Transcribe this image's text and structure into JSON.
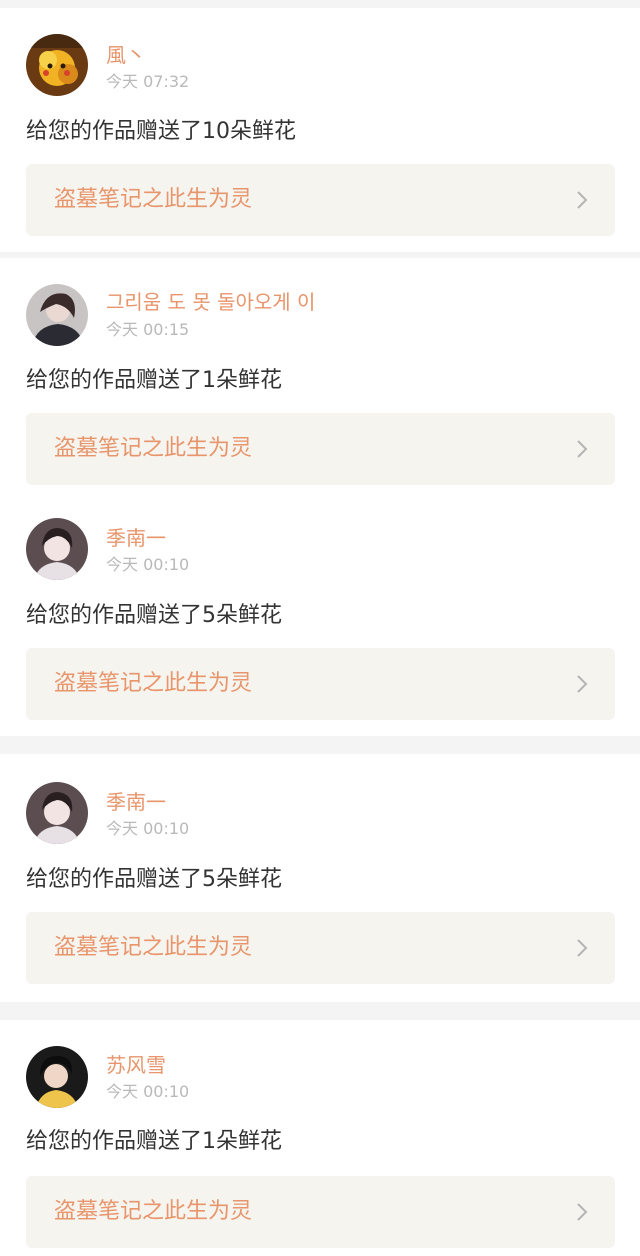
{
  "feed": {
    "items": [
      {
        "username": "風丶",
        "timestamp": "今天 07:32",
        "message": "给您的作品赠送了10朵鲜花",
        "work_title": "盗墓笔记之此生为灵",
        "avatar": "pikachu-avatar"
      },
      {
        "username": "그리움 도 못 돌아오게 이",
        "timestamp": "今天 00:15",
        "message": "给您的作品赠送了1朵鲜花",
        "work_title": "盗墓笔记之此生为灵",
        "avatar": "person-avatar"
      },
      {
        "username": "季南一",
        "timestamp": "今天 00:10",
        "message": "给您的作品赠送了5朵鲜花",
        "work_title": "盗墓笔记之此生为灵",
        "avatar": "person-avatar"
      },
      {
        "username": "季南一",
        "timestamp": "今天 00:10",
        "message": "给您的作品赠送了5朵鲜花",
        "work_title": "盗墓笔记之此生为灵",
        "avatar": "person-avatar"
      },
      {
        "username": "苏风雪",
        "timestamp": "今天 00:10",
        "message": "给您的作品赠送了1朵鲜花",
        "work_title": "盗墓笔记之此生为灵",
        "avatar": "person-avatar"
      }
    ]
  },
  "colors": {
    "accent": "#e8956b",
    "timestamp": "#b9b9b9",
    "text": "#333333",
    "link_bg": "#f5f4ef",
    "page_bg": "#f4f4f4"
  },
  "icons": {
    "chevron": "chevron-right-icon"
  }
}
